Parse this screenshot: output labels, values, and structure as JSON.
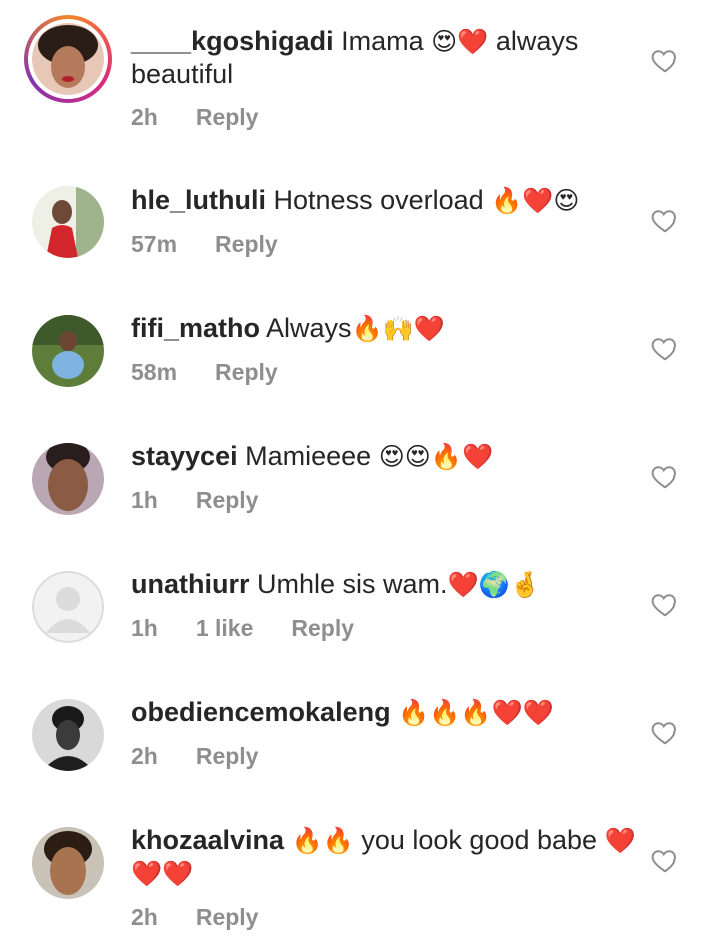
{
  "comments": [
    {
      "username": "____kgoshigadi",
      "text": "Imama",
      "emoji": "😍❤️",
      "text2": "always beautiful",
      "time": "2h",
      "likes": "",
      "reply": "Reply",
      "avatar": "avatar-kgoshigadi",
      "story_ring": true
    },
    {
      "username": "hle_luthuli",
      "text": "Hotness overload",
      "emoji": "🔥❤️😍",
      "text2": "",
      "time": "57m",
      "likes": "",
      "reply": "Reply",
      "avatar": "avatar-hle-luthuli",
      "story_ring": false
    },
    {
      "username": "fifi_matho",
      "text": "Always",
      "emoji": "🔥🙌❤️",
      "text2": "",
      "time": "58m",
      "likes": "",
      "reply": "Reply",
      "avatar": "avatar-fifi-matho",
      "story_ring": false
    },
    {
      "username": "stayycei",
      "text": "Mamieeee",
      "emoji": "😍😍🔥❤️",
      "text2": "",
      "time": "1h",
      "likes": "",
      "reply": "Reply",
      "avatar": "avatar-stayycei",
      "story_ring": false
    },
    {
      "username": "unathiurr",
      "text": "Umhle sis wam.",
      "emoji": "❤️🌍🤞",
      "text2": "",
      "time": "1h",
      "likes": "1 like",
      "reply": "Reply",
      "avatar": "avatar-default",
      "story_ring": false
    },
    {
      "username": "obediencemokaleng",
      "text": "",
      "emoji": "🔥🔥🔥❤️❤️",
      "text2": "",
      "time": "2h",
      "likes": "",
      "reply": "Reply",
      "avatar": "avatar-obediencemokaleng",
      "story_ring": false
    },
    {
      "username": "khozaalvina",
      "text": "",
      "emoji": "🔥🔥",
      "text2": "you look good babe",
      "emoji2": "❤️❤️❤️",
      "time": "2h",
      "likes": "",
      "reply": "Reply",
      "avatar": "avatar-khozaalvina",
      "story_ring": false
    }
  ],
  "icons": {
    "like": "heart-outline-icon"
  },
  "colors": {
    "text": "#262626",
    "meta": "#8e8e8e"
  }
}
